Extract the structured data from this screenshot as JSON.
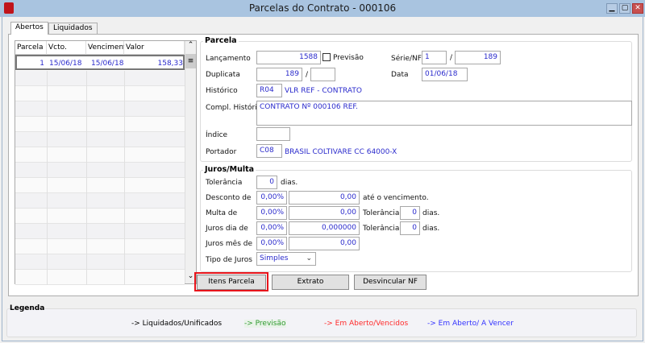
{
  "window": {
    "title": "Parcelas do Contrato - 000106",
    "minimize": "▁",
    "maximize": "▢",
    "close": "✕"
  },
  "tabs": [
    {
      "label": "Abertos"
    },
    {
      "label": "Liquidados"
    }
  ],
  "grid": {
    "columns": [
      "Parcela",
      "Vcto. Orig.",
      "Vencimento",
      "Valor"
    ],
    "rows": [
      {
        "parcela": "1",
        "vcto_orig": "15/06/18",
        "vencimento": "15/06/18",
        "valor": "158,33"
      }
    ],
    "scroll_up": "⌃",
    "scroll_thumb": "≡",
    "scroll_down": "⌄"
  },
  "parcela": {
    "title": "Parcela",
    "lancamento_label": "Lançamento",
    "lancamento": "1588",
    "previsao_label": "Previsão",
    "previsao_checked": false,
    "serie_nf_label": "Série/NF",
    "serie": "1",
    "nf": "189",
    "duplicata_label": "Duplicata",
    "duplicata": "189",
    "duplicata_sub": "",
    "slash": "/",
    "data_label": "Data",
    "data": "01/06/18",
    "historico_label": "Histórico",
    "historico_code": "R04",
    "historico_desc": "VLR REF - CONTRATO",
    "compl_label": "Compl. Histórico",
    "compl": "CONTRATO Nº 000106 REF.",
    "indice_label": "Índice",
    "indice": "",
    "portador_label": "Portador",
    "portador_code": "C08",
    "portador_desc": "BRASIL COLTIVARE CC 64000-X"
  },
  "juros": {
    "title": "Juros/Multa",
    "tolerancia_label": "Tolerância",
    "tolerancia": "0",
    "dias": "dias.",
    "desconto_label": "Desconto de",
    "desconto_pct": "0,00%",
    "desconto_val": "0,00",
    "desconto_suffix": "até o vencimento.",
    "multa_label": "Multa de",
    "multa_pct": "0,00%",
    "multa_val": "0,00",
    "multa_tol": "0",
    "juros_dia_label": "Juros dia de",
    "juros_dia_pct": "0,00%",
    "juros_dia_val": "0,000000",
    "juros_dia_tol": "0",
    "juros_mes_label": "Juros mês de",
    "juros_mes_pct": "0,00%",
    "juros_mes_val": "0,00",
    "tipo_label": "Tipo de Juros",
    "tipo": "Simples"
  },
  "buttons": {
    "itens_parcela": "Itens Parcela",
    "extrato": "Extrato",
    "desvincular": "Desvincular NF"
  },
  "legenda": {
    "title": "Legenda",
    "items": [
      {
        "label": "-> Liquidados/Unificados",
        "color": "#000000"
      },
      {
        "label": "-> Previsão",
        "color": "#2e9a2e"
      },
      {
        "label": "-> Em Aberto/Vencidos",
        "color": "#ff2a2a"
      },
      {
        "label": "-> Em Aberto/ A Vencer",
        "color": "#3333ff"
      }
    ]
  },
  "colors": {
    "titlebar": "#a9c4e0",
    "highlight": "#e8141b"
  }
}
